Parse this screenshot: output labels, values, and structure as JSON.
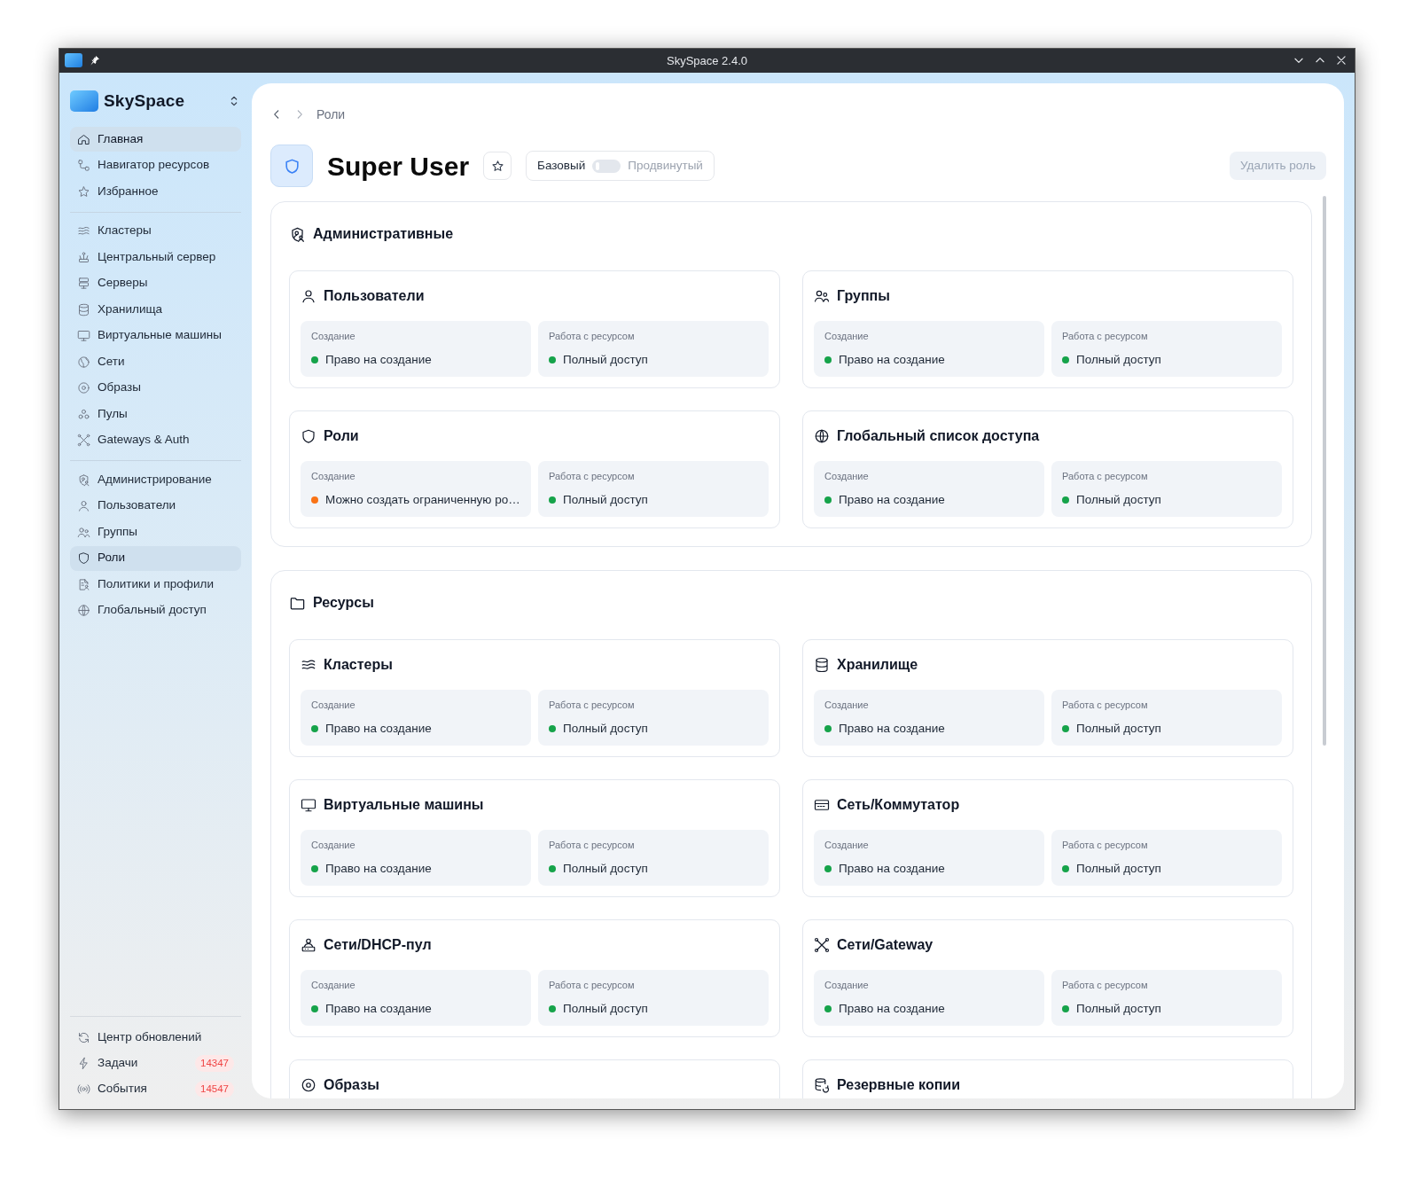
{
  "window": {
    "title": "SkySpace 2.4.0"
  },
  "sidebar": {
    "app_name": "SkySpace",
    "groups": [
      [
        {
          "label": "Главная",
          "selected": true
        },
        {
          "label": "Навигатор ресурсов",
          "selected": false
        },
        {
          "label": "Избранное",
          "selected": false
        }
      ],
      [
        {
          "label": "Кластеры",
          "selected": false
        },
        {
          "label": "Центральный сервер",
          "selected": false
        },
        {
          "label": "Серверы",
          "selected": false
        },
        {
          "label": "Хранилища",
          "selected": false
        },
        {
          "label": "Виртуальные машины",
          "selected": false
        },
        {
          "label": "Сети",
          "selected": false
        },
        {
          "label": "Образы",
          "selected": false
        },
        {
          "label": "Пулы",
          "selected": false
        },
        {
          "label": "Gateways & Auth",
          "selected": false
        }
      ],
      [
        {
          "label": "Администрирование",
          "selected": false
        },
        {
          "label": "Пользователи",
          "selected": false
        },
        {
          "label": "Группы",
          "selected": false
        },
        {
          "label": "Роли",
          "selected": true
        },
        {
          "label": "Политики и профили",
          "selected": false
        },
        {
          "label": "Глобальный доступ",
          "selected": false
        }
      ]
    ],
    "footer": [
      {
        "label": "Центр обновлений"
      },
      {
        "label": "Задачи",
        "badge": "14347"
      },
      {
        "label": "События",
        "badge": "14547"
      }
    ]
  },
  "breadcrumb": "Роли",
  "header": {
    "title": "Super User",
    "mode_toggle": {
      "left": "Базовый",
      "right": "Продвинутый",
      "on": false
    },
    "delete_button": {
      "label": "Удалить роль",
      "disabled": true
    }
  },
  "sections": [
    {
      "title": "Административные",
      "cards": [
        {
          "title": "Пользователи",
          "permissions": [
            {
              "label": "Создание",
              "value": "Право на создание",
              "color": "#16a34a"
            },
            {
              "label": "Работа с ресурсом",
              "value": "Полный доступ",
              "color": "#16a34a"
            }
          ]
        },
        {
          "title": "Группы",
          "permissions": [
            {
              "label": "Создание",
              "value": "Право на создание",
              "color": "#16a34a"
            },
            {
              "label": "Работа с ресурсом",
              "value": "Полный доступ",
              "color": "#16a34a"
            }
          ]
        },
        {
          "title": "Роли",
          "permissions": [
            {
              "label": "Создание",
              "value": "Можно создать ограниченную ро…",
              "color": "#f97316"
            },
            {
              "label": "Работа с ресурсом",
              "value": "Полный доступ",
              "color": "#16a34a"
            }
          ]
        },
        {
          "title": "Глобальный список доступа",
          "permissions": [
            {
              "label": "Создание",
              "value": "Право на создание",
              "color": "#16a34a"
            },
            {
              "label": "Работа с ресурсом",
              "value": "Полный доступ",
              "color": "#16a34a"
            }
          ]
        }
      ]
    },
    {
      "title": "Ресурсы",
      "cards": [
        {
          "title": "Кластеры",
          "permissions": [
            {
              "label": "Создание",
              "value": "Право на создание",
              "color": "#16a34a"
            },
            {
              "label": "Работа с ресурсом",
              "value": "Полный доступ",
              "color": "#16a34a"
            }
          ]
        },
        {
          "title": "Хранилище",
          "permissions": [
            {
              "label": "Создание",
              "value": "Право на создание",
              "color": "#16a34a"
            },
            {
              "label": "Работа с ресурсом",
              "value": "Полный доступ",
              "color": "#16a34a"
            }
          ]
        },
        {
          "title": "Виртуальные машины",
          "permissions": [
            {
              "label": "Создание",
              "value": "Право на создание",
              "color": "#16a34a"
            },
            {
              "label": "Работа с ресурсом",
              "value": "Полный доступ",
              "color": "#16a34a"
            }
          ]
        },
        {
          "title": "Сеть/Коммутатор",
          "permissions": [
            {
              "label": "Создание",
              "value": "Право на создание",
              "color": "#16a34a"
            },
            {
              "label": "Работа с ресурсом",
              "value": "Полный доступ",
              "color": "#16a34a"
            }
          ]
        },
        {
          "title": "Сети/DHCP-пул",
          "permissions": [
            {
              "label": "Создание",
              "value": "Право на создание",
              "color": "#16a34a"
            },
            {
              "label": "Работа с ресурсом",
              "value": "Полный доступ",
              "color": "#16a34a"
            }
          ]
        },
        {
          "title": "Сети/Gateway",
          "permissions": [
            {
              "label": "Создание",
              "value": "Право на создание",
              "color": "#16a34a"
            },
            {
              "label": "Работа с ресурсом",
              "value": "Полный доступ",
              "color": "#16a34a"
            }
          ]
        },
        {
          "title": "Образы"
        },
        {
          "title": "Резервные копии"
        }
      ]
    }
  ]
}
